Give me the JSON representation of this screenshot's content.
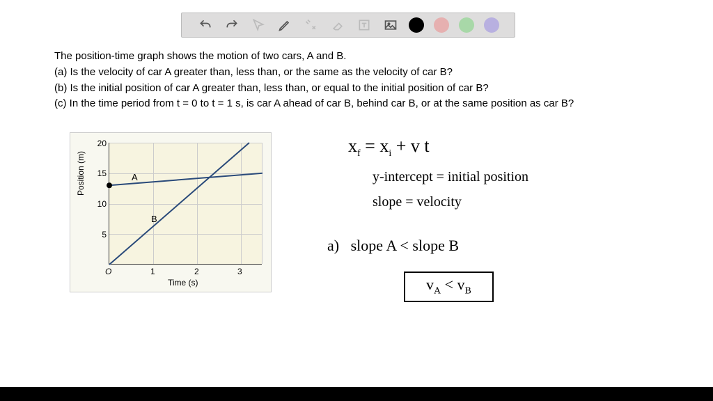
{
  "toolbar": {
    "colors": {
      "black": "#000000",
      "red": "#e6b0b0",
      "green": "#a8d8a8",
      "purple": "#b8b0e0"
    }
  },
  "problem": {
    "intro": "The position-time graph shows the motion of two cars, A and B.",
    "a": "(a) Is the velocity of car A greater than, less than, or the same as the velocity of car B?",
    "b": "(b) Is the initial position of car A greater than, less than, or equal to the initial position of car B?",
    "c": "(c) In the time period from t = 0 to t = 1 s, is car A ahead of car B, behind car B, or at the same position as car B?"
  },
  "chart_data": {
    "type": "line",
    "title": "",
    "xlabel": "Time (s)",
    "ylabel": "Position (m)",
    "xlim": [
      0,
      3.5
    ],
    "ylim": [
      0,
      20
    ],
    "x_ticks": [
      "O",
      "1",
      "2",
      "3"
    ],
    "y_ticks": [
      "5",
      "10",
      "15",
      "20"
    ],
    "series": [
      {
        "name": "A",
        "points": [
          [
            0,
            13
          ],
          [
            3.5,
            15
          ]
        ]
      },
      {
        "name": "B",
        "points": [
          [
            0,
            0
          ],
          [
            3.2,
            20
          ]
        ]
      }
    ],
    "marker": {
      "x": 0,
      "y": 13
    }
  },
  "handwriting": {
    "eq1_lhs": "x",
    "eq1_sub_f": "f",
    "eq1_mid": " = x",
    "eq1_sub_i": "i",
    "eq1_tail": " + v t",
    "line2": "y-intercept = initial position",
    "line3": "slope = velocity",
    "part_a_label": "a)",
    "part_a_text": "slope A < slope B",
    "boxed_left": "v",
    "boxed_sub_a": "A",
    "boxed_mid": " < v",
    "boxed_sub_b": "B"
  }
}
